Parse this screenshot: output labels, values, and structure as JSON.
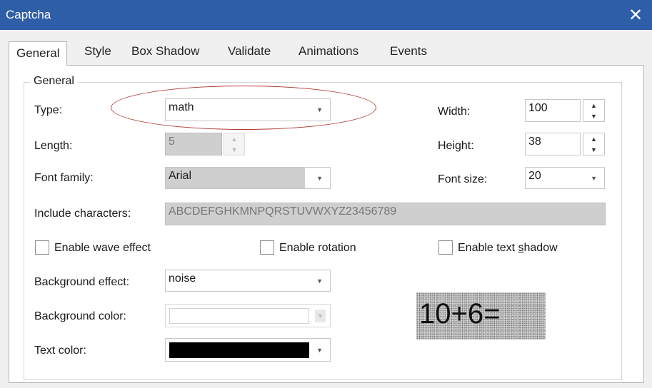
{
  "window": {
    "title": "Captcha",
    "close_glyph": "✕"
  },
  "tabs": [
    {
      "label": "General",
      "active": true
    },
    {
      "label": "Style"
    },
    {
      "label": "Box Shadow"
    },
    {
      "label": "Validate"
    },
    {
      "label": "Animations"
    },
    {
      "label": "Events"
    }
  ],
  "group": {
    "title": "General"
  },
  "fields": {
    "type": {
      "label": "Type:",
      "value": "math"
    },
    "length": {
      "label": "Length:",
      "value": "5"
    },
    "font_family": {
      "label": "Font family:",
      "value": "Arial"
    },
    "include_chars": {
      "label": "Include characters:",
      "value": "ABCDEFGHKMNPQRSTUVWXYZ23456789"
    },
    "width": {
      "label": "Width:",
      "value": "100"
    },
    "height": {
      "label": "Height:",
      "value": "38"
    },
    "font_size": {
      "label": "Font size:",
      "value": "20"
    },
    "bg_effect": {
      "label": "Background effect:",
      "value": "noise"
    },
    "bg_color": {
      "label": "Background color:",
      "value": ""
    },
    "text_color": {
      "label": "Text color:",
      "value": "#000000"
    }
  },
  "checkboxes": {
    "wave": {
      "label": "Enable wave effect",
      "checked": false
    },
    "rotation": {
      "label": "Enable rotation",
      "checked": false
    },
    "shadow_prefix": "Enable text ",
    "shadow_underlined": "s",
    "shadow_suffix": "hadow",
    "shadow_checked": false
  },
  "preview": {
    "text": "10+6="
  },
  "icons": {
    "spin_up": "▲",
    "spin_down": "▼",
    "dropdown": "▼"
  },
  "colors": {
    "titlebar": "#2f5ea9",
    "annotation": "#b03a2e"
  }
}
